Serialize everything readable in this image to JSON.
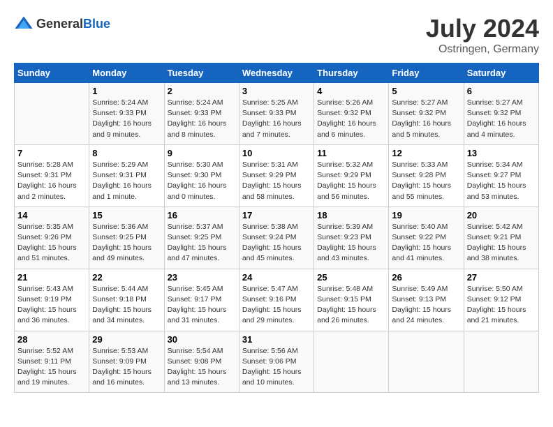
{
  "header": {
    "logo_general": "General",
    "logo_blue": "Blue",
    "month_year": "July 2024",
    "location": "Ostringen, Germany"
  },
  "weekdays": [
    "Sunday",
    "Monday",
    "Tuesday",
    "Wednesday",
    "Thursday",
    "Friday",
    "Saturday"
  ],
  "weeks": [
    [
      {
        "day": "",
        "info": ""
      },
      {
        "day": "1",
        "info": "Sunrise: 5:24 AM\nSunset: 9:33 PM\nDaylight: 16 hours\nand 9 minutes."
      },
      {
        "day": "2",
        "info": "Sunrise: 5:24 AM\nSunset: 9:33 PM\nDaylight: 16 hours\nand 8 minutes."
      },
      {
        "day": "3",
        "info": "Sunrise: 5:25 AM\nSunset: 9:33 PM\nDaylight: 16 hours\nand 7 minutes."
      },
      {
        "day": "4",
        "info": "Sunrise: 5:26 AM\nSunset: 9:32 PM\nDaylight: 16 hours\nand 6 minutes."
      },
      {
        "day": "5",
        "info": "Sunrise: 5:27 AM\nSunset: 9:32 PM\nDaylight: 16 hours\nand 5 minutes."
      },
      {
        "day": "6",
        "info": "Sunrise: 5:27 AM\nSunset: 9:32 PM\nDaylight: 16 hours\nand 4 minutes."
      }
    ],
    [
      {
        "day": "7",
        "info": "Sunrise: 5:28 AM\nSunset: 9:31 PM\nDaylight: 16 hours\nand 2 minutes."
      },
      {
        "day": "8",
        "info": "Sunrise: 5:29 AM\nSunset: 9:31 PM\nDaylight: 16 hours\nand 1 minute."
      },
      {
        "day": "9",
        "info": "Sunrise: 5:30 AM\nSunset: 9:30 PM\nDaylight: 16 hours\nand 0 minutes."
      },
      {
        "day": "10",
        "info": "Sunrise: 5:31 AM\nSunset: 9:29 PM\nDaylight: 15 hours\nand 58 minutes."
      },
      {
        "day": "11",
        "info": "Sunrise: 5:32 AM\nSunset: 9:29 PM\nDaylight: 15 hours\nand 56 minutes."
      },
      {
        "day": "12",
        "info": "Sunrise: 5:33 AM\nSunset: 9:28 PM\nDaylight: 15 hours\nand 55 minutes."
      },
      {
        "day": "13",
        "info": "Sunrise: 5:34 AM\nSunset: 9:27 PM\nDaylight: 15 hours\nand 53 minutes."
      }
    ],
    [
      {
        "day": "14",
        "info": "Sunrise: 5:35 AM\nSunset: 9:26 PM\nDaylight: 15 hours\nand 51 minutes."
      },
      {
        "day": "15",
        "info": "Sunrise: 5:36 AM\nSunset: 9:25 PM\nDaylight: 15 hours\nand 49 minutes."
      },
      {
        "day": "16",
        "info": "Sunrise: 5:37 AM\nSunset: 9:25 PM\nDaylight: 15 hours\nand 47 minutes."
      },
      {
        "day": "17",
        "info": "Sunrise: 5:38 AM\nSunset: 9:24 PM\nDaylight: 15 hours\nand 45 minutes."
      },
      {
        "day": "18",
        "info": "Sunrise: 5:39 AM\nSunset: 9:23 PM\nDaylight: 15 hours\nand 43 minutes."
      },
      {
        "day": "19",
        "info": "Sunrise: 5:40 AM\nSunset: 9:22 PM\nDaylight: 15 hours\nand 41 minutes."
      },
      {
        "day": "20",
        "info": "Sunrise: 5:42 AM\nSunset: 9:21 PM\nDaylight: 15 hours\nand 38 minutes."
      }
    ],
    [
      {
        "day": "21",
        "info": "Sunrise: 5:43 AM\nSunset: 9:19 PM\nDaylight: 15 hours\nand 36 minutes."
      },
      {
        "day": "22",
        "info": "Sunrise: 5:44 AM\nSunset: 9:18 PM\nDaylight: 15 hours\nand 34 minutes."
      },
      {
        "day": "23",
        "info": "Sunrise: 5:45 AM\nSunset: 9:17 PM\nDaylight: 15 hours\nand 31 minutes."
      },
      {
        "day": "24",
        "info": "Sunrise: 5:47 AM\nSunset: 9:16 PM\nDaylight: 15 hours\nand 29 minutes."
      },
      {
        "day": "25",
        "info": "Sunrise: 5:48 AM\nSunset: 9:15 PM\nDaylight: 15 hours\nand 26 minutes."
      },
      {
        "day": "26",
        "info": "Sunrise: 5:49 AM\nSunset: 9:13 PM\nDaylight: 15 hours\nand 24 minutes."
      },
      {
        "day": "27",
        "info": "Sunrise: 5:50 AM\nSunset: 9:12 PM\nDaylight: 15 hours\nand 21 minutes."
      }
    ],
    [
      {
        "day": "28",
        "info": "Sunrise: 5:52 AM\nSunset: 9:11 PM\nDaylight: 15 hours\nand 19 minutes."
      },
      {
        "day": "29",
        "info": "Sunrise: 5:53 AM\nSunset: 9:09 PM\nDaylight: 15 hours\nand 16 minutes."
      },
      {
        "day": "30",
        "info": "Sunrise: 5:54 AM\nSunset: 9:08 PM\nDaylight: 15 hours\nand 13 minutes."
      },
      {
        "day": "31",
        "info": "Sunrise: 5:56 AM\nSunset: 9:06 PM\nDaylight: 15 hours\nand 10 minutes."
      },
      {
        "day": "",
        "info": ""
      },
      {
        "day": "",
        "info": ""
      },
      {
        "day": "",
        "info": ""
      }
    ]
  ]
}
